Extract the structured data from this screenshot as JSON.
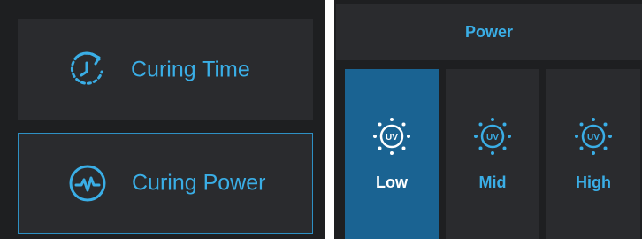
{
  "menu": {
    "curing_time_label": "Curing Time",
    "curing_power_label": "Curing Power",
    "curing_time_icon": "clock-refresh-icon",
    "curing_power_icon": "power-pulse-icon",
    "selected": "curing_power"
  },
  "power_panel": {
    "title": "Power",
    "levels": [
      {
        "label": "Low",
        "icon": "uv-sun-icon",
        "uv_text": "UV",
        "selected": true
      },
      {
        "label": "Mid",
        "icon": "uv-sun-icon",
        "uv_text": "UV",
        "selected": false
      },
      {
        "label": "High",
        "icon": "uv-sun-icon",
        "uv_text": "UV",
        "selected": false
      }
    ]
  },
  "colors": {
    "accent": "#3aaee6",
    "background": "#1e1f21",
    "panel": "#2a2b2e",
    "selected_fill": "#1a6392"
  }
}
